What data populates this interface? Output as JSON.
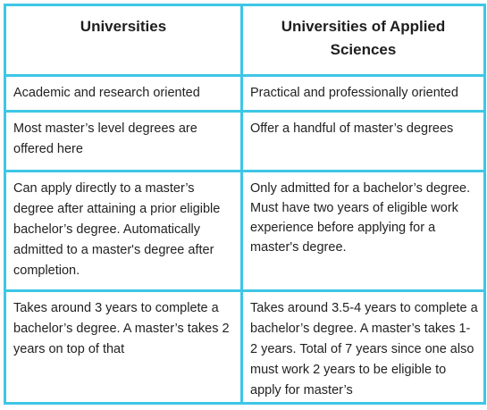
{
  "table": {
    "headers": [
      "Universities",
      "Universities of Applied Sciences"
    ],
    "rows": [
      {
        "university": "Academic and research oriented",
        "applied": "Practical and professionally oriented"
      },
      {
        "university": "Most master’s level degrees are offered here",
        "applied": "Offer a handful of master’s degrees"
      },
      {
        "university": "Can apply directly to a master’s degree after attaining a prior eligible bachelor’s degree. Automatically admitted to a master's degree after completion.",
        "applied": "Only admitted for a bachelor’s degree. Must have two years of eligible work experience before applying for a master's degree."
      },
      {
        "university": "Takes around 3 years to complete a bachelor’s degree. A master’s takes 2 years on top of that",
        "applied": "Takes around 3.5-4 years to complete a bachelor’s degree. A master’s takes 1- 2 years. Total of 7 years since one also must work 2 years to be eligible to apply for master’s"
      }
    ]
  },
  "colors": {
    "border": "#3ec6e6",
    "text": "#222222",
    "background": "#ffffff"
  }
}
